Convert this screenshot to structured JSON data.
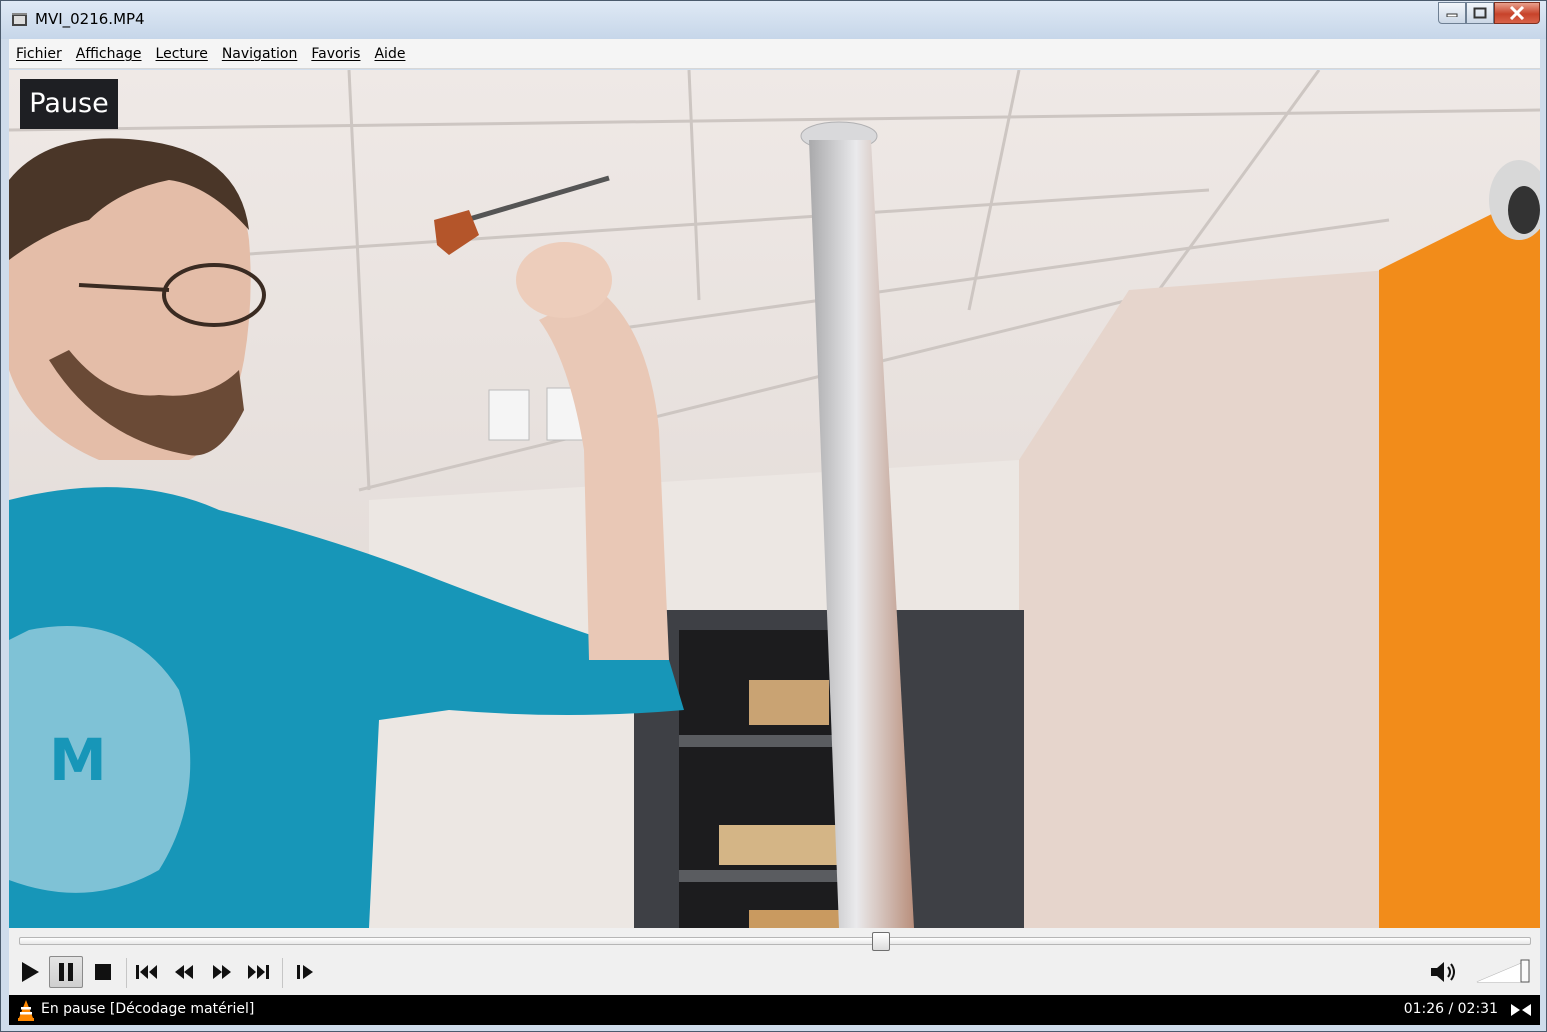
{
  "window": {
    "title": "MVI_0216.MP4"
  },
  "menu": {
    "items": [
      "Fichier",
      "Affichage",
      "Lecture",
      "Navigation",
      "Favoris",
      "Aide"
    ]
  },
  "video": {
    "osd_text": "Pause"
  },
  "controls": {
    "progress": 0.57,
    "volume": 1.0,
    "icons": [
      "play-icon",
      "pause-icon",
      "stop-icon",
      "previous-icon",
      "rewind-icon",
      "fast-forward-icon",
      "next-icon",
      "frame-step-icon",
      "volume-icon"
    ]
  },
  "status": {
    "text": "En pause [Décodage matériel]",
    "time": "01:26 / 02:31"
  },
  "colors": {
    "accent_orange": "#ff8800",
    "statusbar": "#000000",
    "hoodie": "#1796b8"
  }
}
